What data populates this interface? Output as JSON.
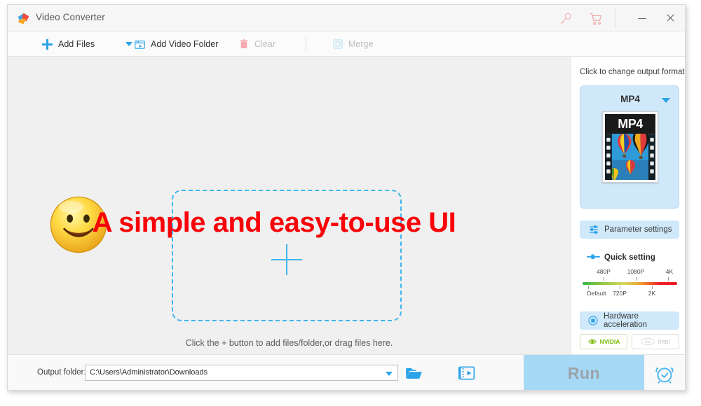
{
  "window": {
    "title": "Video Converter",
    "logo_icon": "app-logo-icon",
    "controls": {
      "key_icon": "key-icon",
      "cart_icon": "shopping-cart-icon",
      "minimize_icon": "minimize-icon",
      "close_icon": "close-icon"
    }
  },
  "toolbar": {
    "add_files": {
      "label": "Add Files",
      "icon": "plus-icon",
      "enabled": true
    },
    "add_files_dropdown": {
      "icon": "chevron-down-icon",
      "enabled": true
    },
    "add_video_folder": {
      "label": "Add Video Folder",
      "icon": "folder-video-icon",
      "enabled": true
    },
    "clear": {
      "label": "Clear",
      "icon": "trash-icon",
      "enabled": false
    },
    "merge": {
      "label": "Merge",
      "icon": "merge-squares-icon",
      "enabled": false
    }
  },
  "main": {
    "banner_text": "A simple and easy-to-use UI",
    "banner_color": "#fa0008",
    "smiley_icon": "smiley-face-icon",
    "dropzone_plus_icon": "plus-icon",
    "hint": "Click the + button to add files/folder,or drag files here."
  },
  "sidebar": {
    "caption": "Click to change output format:",
    "format": {
      "name": "MP4",
      "caret_icon": "chevron-down-icon",
      "thumbnail_label": "MP4",
      "thumbnail_icon": "hot-air-balloons-filmstrip-thumbnail"
    },
    "parameter_settings": {
      "label": "Parameter settings",
      "icon": "sliders-icon"
    },
    "quick_setting": {
      "label": "Quick setting",
      "icon": "slider-handle-icon"
    },
    "quality_slider": {
      "top_labels": [
        "480P",
        "1080P",
        "4K"
      ],
      "bottom_labels": [
        "Default",
        "720P",
        "2K"
      ],
      "gradient": [
        "#36b54a",
        "#d9d95a",
        "#ee1c25"
      ]
    },
    "hardware_acceleration": {
      "label": "Hardware acceleration",
      "icon": "chip-icon"
    },
    "hw_options": [
      {
        "label": "NVIDIA",
        "icon": "nvidia-eye-icon",
        "enabled": true,
        "color": "#76b900"
      },
      {
        "label": "Intel",
        "icon": "intel-icon",
        "enabled": false,
        "color": "#c4c4c4"
      }
    ]
  },
  "bottom": {
    "output_label": "Output folder:",
    "output_path": "C:\\Users\\Administrator\\Downloads",
    "output_dropdown_icon": "chevron-down-icon",
    "open_folder_icon": "open-folder-icon",
    "media_preview_icon": "media-file-icon",
    "run_button": {
      "label": "Run",
      "enabled": false,
      "color": "#a6d9f5"
    },
    "alarm_icon": "alarm-clock-icon"
  }
}
